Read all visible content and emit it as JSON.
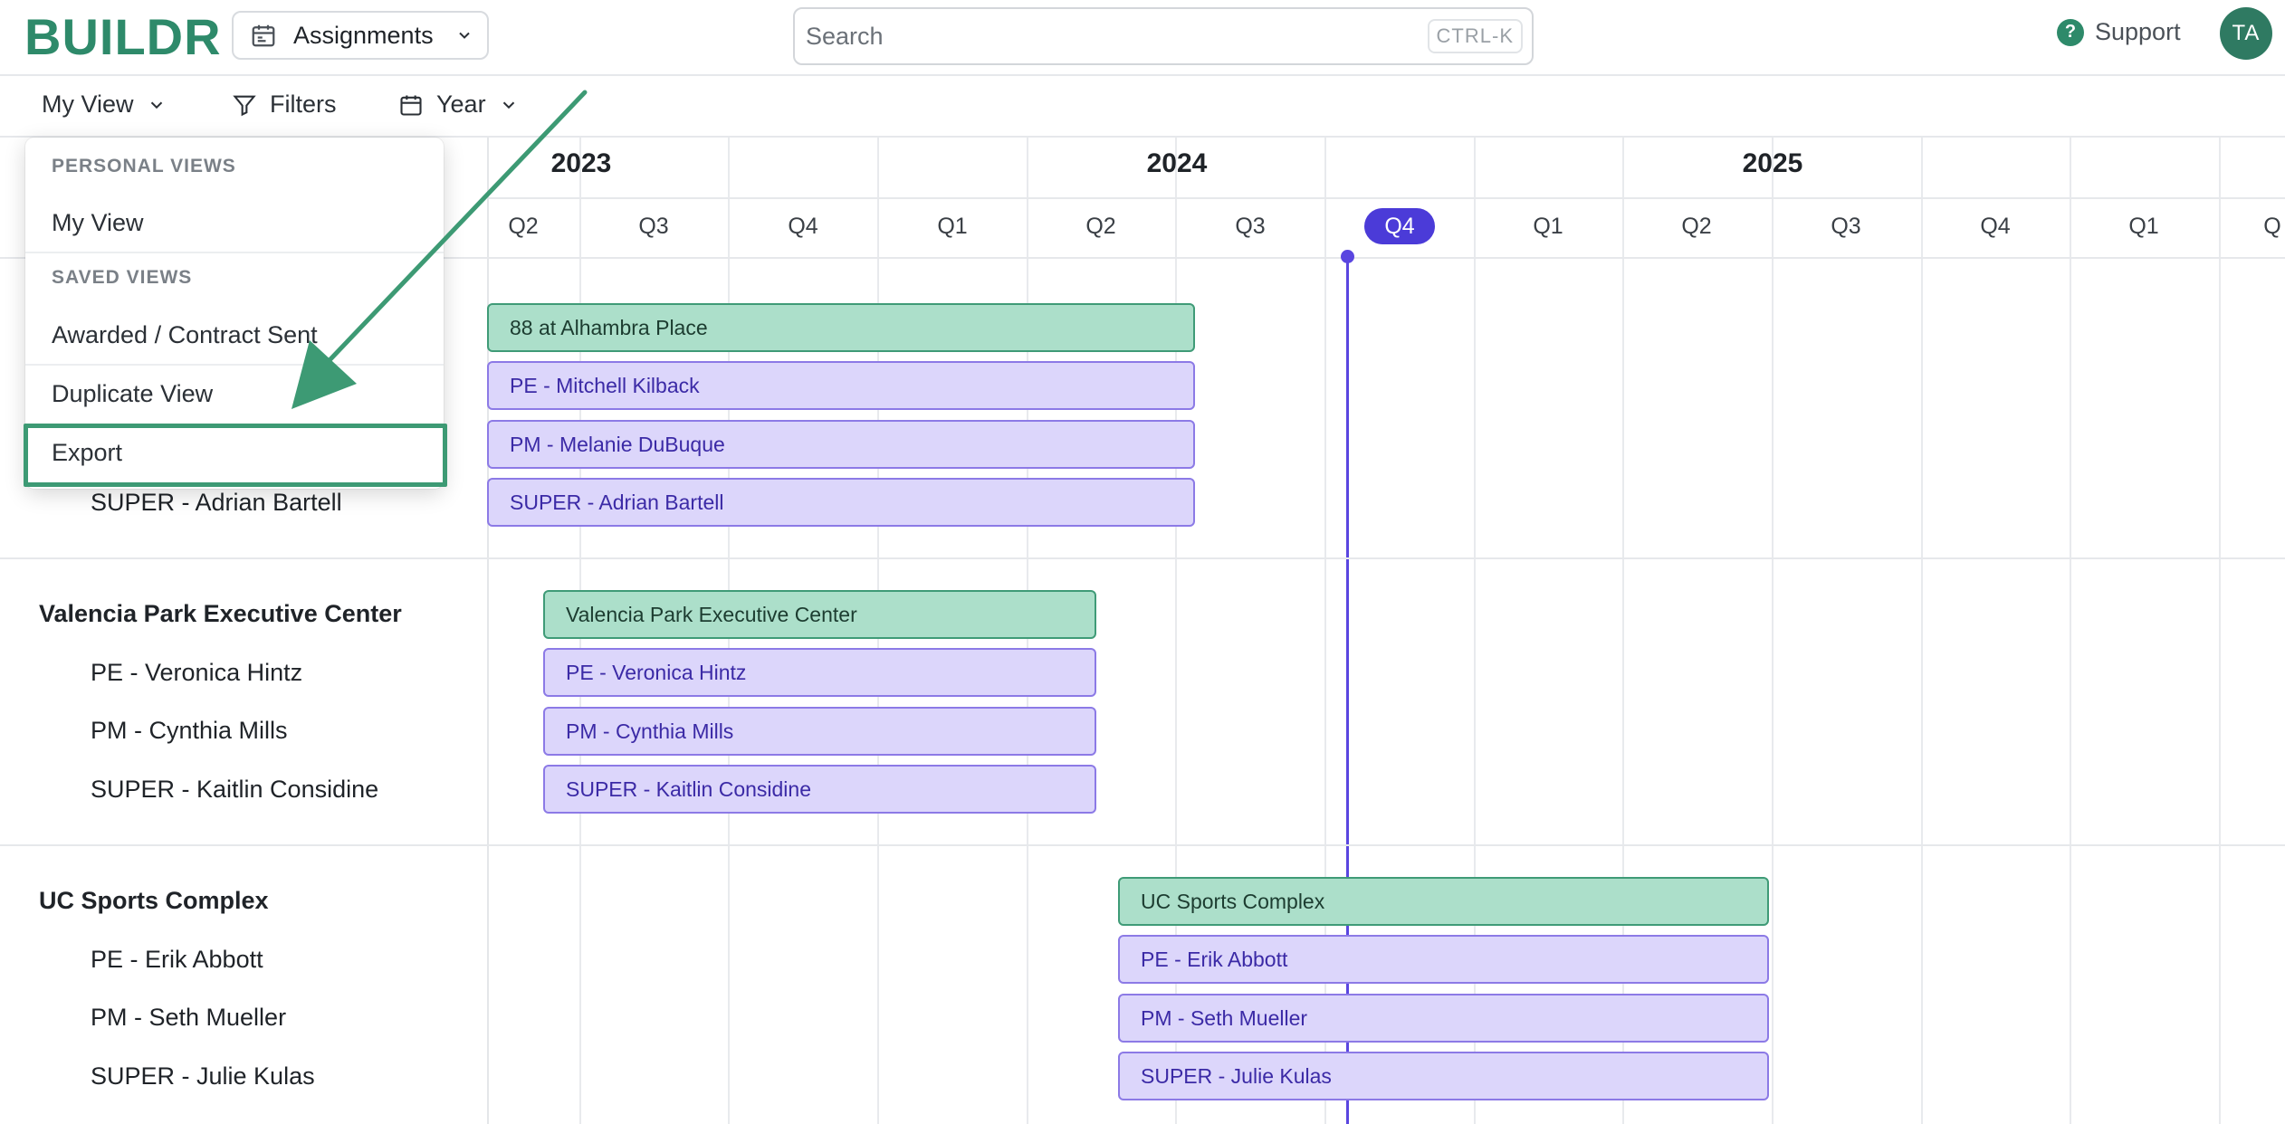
{
  "nav": {
    "logo": "BUILDR",
    "module": "Assignments",
    "search_placeholder": "Search",
    "search_shortcut": "CTRL-K",
    "support": "Support",
    "avatar_initials": "TA"
  },
  "toolbar": {
    "view": "My View",
    "filters": "Filters",
    "range": "Year"
  },
  "menu": {
    "personal_header": "PERSONAL VIEWS",
    "personal_item": "My View",
    "saved_header": "SAVED VIEWS",
    "saved_item": "Awarded / Contract Sent",
    "duplicate": "Duplicate View",
    "export": "Export"
  },
  "timeline": {
    "years": [
      "2023",
      "2024",
      "2025"
    ],
    "quarters": [
      "Q2",
      "Q3",
      "Q4",
      "Q1",
      "Q2",
      "Q3",
      "Q4",
      "Q1",
      "Q2",
      "Q3",
      "Q4",
      "Q1",
      "Q"
    ],
    "current_quarter": "Q4",
    "current_quarter_index": 6
  },
  "projects": [
    {
      "name": "88 at Alhambra Place",
      "members": [
        "PE - Mitchell Kilback",
        "PM - Melanie DuBuque",
        "SUPER - Adrian Bartell"
      ]
    },
    {
      "name": "Valencia Park Executive Center",
      "members": [
        "PE - Veronica Hintz",
        "PM - Cynthia Mills",
        "SUPER - Kaitlin Considine"
      ]
    },
    {
      "name": "UC Sports Complex",
      "members": [
        "PE - Erik Abbott",
        "PM - Seth Mueller",
        "SUPER - Julie Kulas"
      ]
    }
  ],
  "colors": {
    "brand": "#2e8a6a",
    "project_bar": "#acdfca",
    "person_bar": "#dcd6fb",
    "today": "#4b3bd8",
    "highlight": "#3d9a74"
  }
}
